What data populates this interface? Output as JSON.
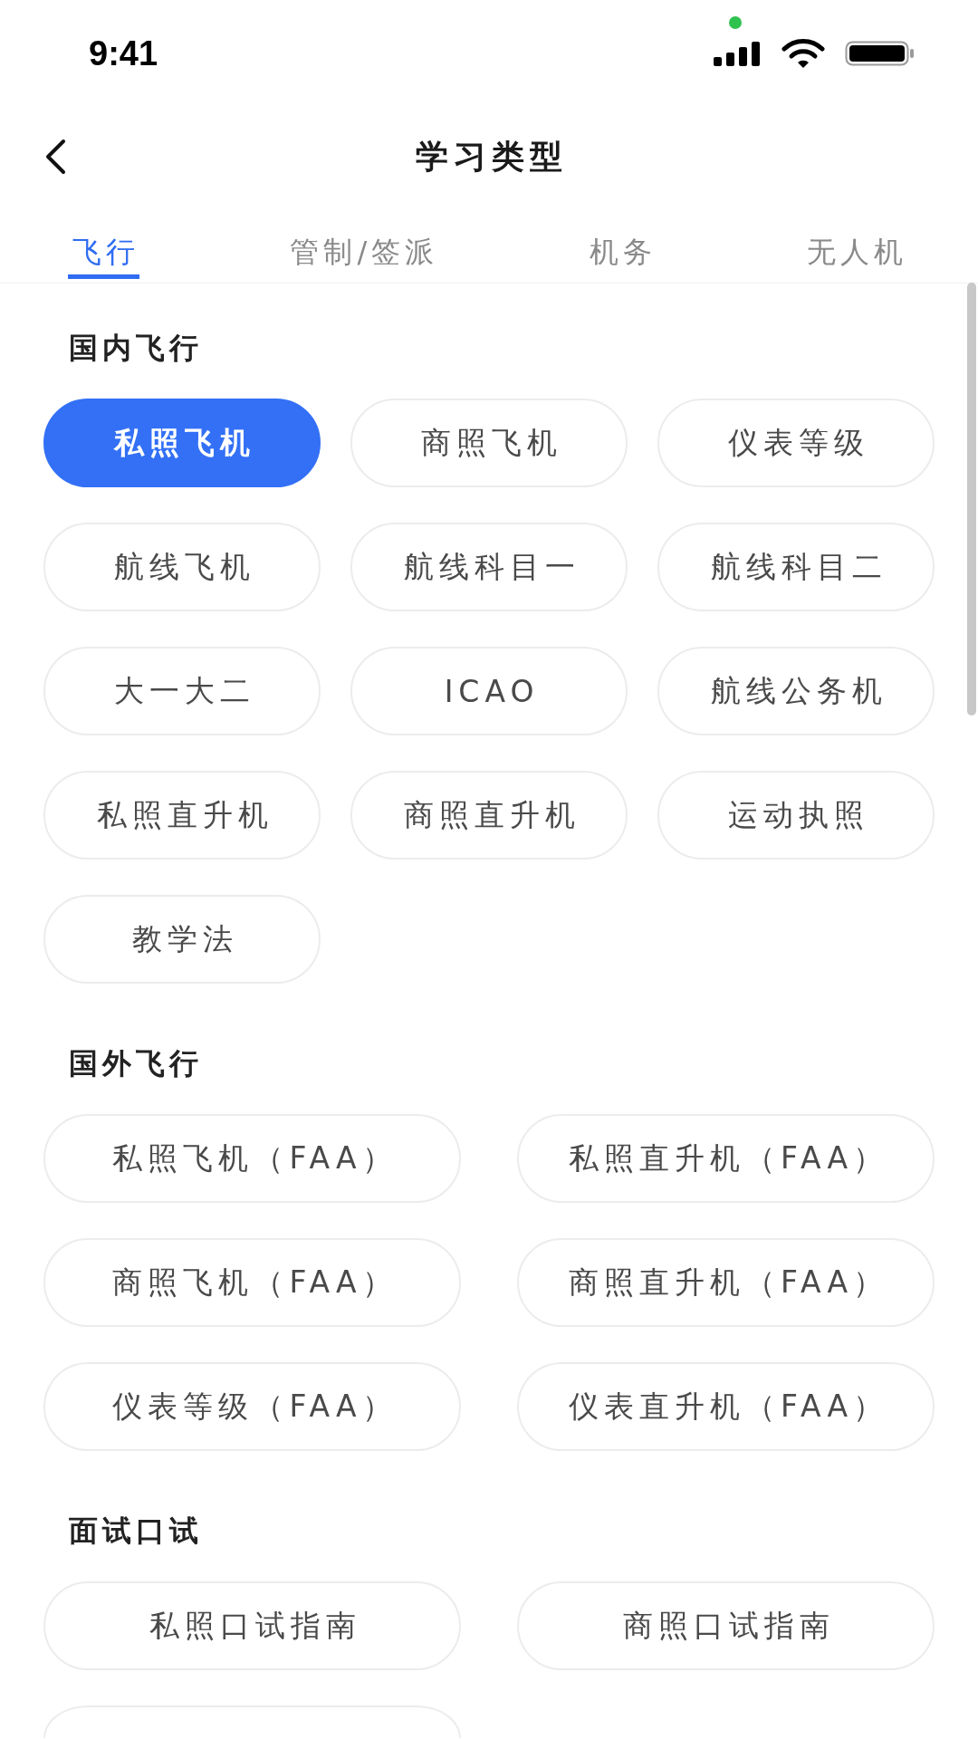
{
  "status_bar": {
    "time": "9:41"
  },
  "header": {
    "title": "学习类型"
  },
  "tabs": [
    {
      "label": "飞行",
      "selected": true
    },
    {
      "label": "管制/签派",
      "selected": false
    },
    {
      "label": "机务",
      "selected": false
    },
    {
      "label": "无人机",
      "selected": false
    }
  ],
  "sections": [
    {
      "title": "国内飞行",
      "kind": "short",
      "chips": [
        {
          "label": "私照飞机",
          "selected": true
        },
        {
          "label": "商照飞机",
          "selected": false
        },
        {
          "label": "仪表等级",
          "selected": false
        },
        {
          "label": "航线飞机",
          "selected": false
        },
        {
          "label": "航线科目一",
          "selected": false
        },
        {
          "label": "航线科目二",
          "selected": false
        },
        {
          "label": "大一大二",
          "selected": false
        },
        {
          "label": "ICAO",
          "selected": false
        },
        {
          "label": "航线公务机",
          "selected": false
        },
        {
          "label": "私照直升机",
          "selected": false
        },
        {
          "label": "商照直升机",
          "selected": false
        },
        {
          "label": "运动执照",
          "selected": false
        },
        {
          "label": "教学法",
          "selected": false
        }
      ]
    },
    {
      "title": "国外飞行",
      "kind": "long",
      "chips": [
        {
          "label": "私照飞机（FAA）",
          "selected": false
        },
        {
          "label": "私照直升机（FAA）",
          "selected": false
        },
        {
          "label": "商照飞机（FAA）",
          "selected": false
        },
        {
          "label": "商照直升机（FAA）",
          "selected": false
        },
        {
          "label": "仪表等级（FAA）",
          "selected": false
        },
        {
          "label": "仪表直升机（FAA）",
          "selected": false
        }
      ]
    },
    {
      "title": "面试口试",
      "kind": "long",
      "chips": [
        {
          "label": "私照口试指南",
          "selected": false
        },
        {
          "label": "商照口试指南",
          "selected": false
        },
        {
          "selected": false
        }
      ]
    }
  ]
}
